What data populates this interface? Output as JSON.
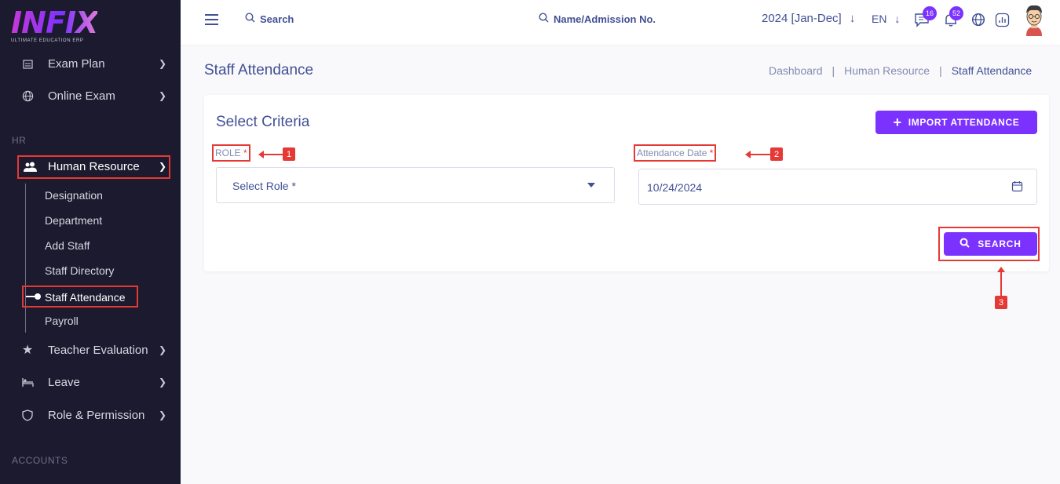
{
  "logo": {
    "text": "INFIX",
    "subtitle": "ULTIMATE EDUCATION ERP"
  },
  "sidebar": {
    "exam_plan": "Exam Plan",
    "online_exam": "Online Exam",
    "section_hr": "HR",
    "human_resource": "Human Resource",
    "submenu": [
      "Designation",
      "Department",
      "Add Staff",
      "Staff Directory",
      "Staff Attendance",
      "Payroll"
    ],
    "teacher_evaluation": "Teacher Evaluation",
    "leave": "Leave",
    "role_permission": "Role & Permission",
    "section_accounts": "ACCOUNTS"
  },
  "header": {
    "search_placeholder": "Search",
    "name_search": "Name/Admission No.",
    "year": "2024 [Jan-Dec]",
    "lang": "EN",
    "messages_count": "16",
    "notifications_count": "52"
  },
  "page": {
    "title": "Staff Attendance",
    "breadcrumb": [
      "Dashboard",
      "Human Resource",
      "Staff Attendance"
    ]
  },
  "form": {
    "title": "Select Criteria",
    "import_label": "IMPORT ATTENDANCE",
    "role_label": "ROLE",
    "role_placeholder": "Select Role *",
    "date_label": "Attendance Date",
    "date_value": "10/24/2024",
    "required_mark": "*",
    "search_label": "SEARCH"
  },
  "annotations": [
    "1",
    "2",
    "3"
  ],
  "colors": {
    "accent": "#7c32ff",
    "sidebar_bg": "#1b1a2e",
    "highlight": "#e53935",
    "text": "#415094"
  }
}
